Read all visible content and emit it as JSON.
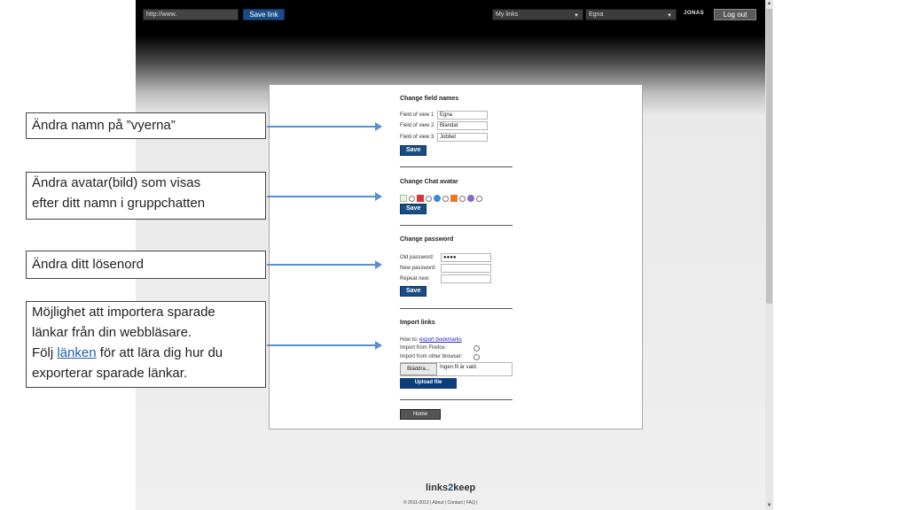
{
  "topbar": {
    "url_value": "http://www.",
    "save_link_label": "Save link",
    "links_select": "My links",
    "views_select": "Egna",
    "username": "JONAS",
    "logout_label": "Log out"
  },
  "panel": {
    "field_names": {
      "title": "Change field names",
      "rows": [
        {
          "label": "Field of view 1",
          "value": "Egna"
        },
        {
          "label": "Field of view 2",
          "value": "Blandat"
        },
        {
          "label": "Field of view 3",
          "value": "Jobbet"
        }
      ],
      "save_label": "Save"
    },
    "avatar": {
      "title": "Change Chat avatar",
      "save_label": "Save"
    },
    "password": {
      "title": "Change password",
      "old_label": "Old password:",
      "old_value": "●●●●",
      "new_label": "New password:",
      "repeat_label": "Repeat new:",
      "save_label": "Save"
    },
    "import": {
      "title": "Import links",
      "howto_label": "How to:",
      "howto_link": "export bookmarks",
      "firefox_label": "Import from Firefox:",
      "other_label": "Import from other browser:",
      "browse_label": "Bläddra...",
      "no_file_label": "Ingen fil är vald.",
      "upload_label": "Upload file"
    },
    "home_label": "Home"
  },
  "footer": {
    "brand_a": "links",
    "brand_b": "2",
    "brand_c": "keep",
    "links_text": "© 2011-2013 | About | Contact | FAQ |"
  },
  "callouts": {
    "views": "Ändra namn på ”vyerna”",
    "avatar_1": "Ändra avatar(bild) som visas",
    "avatar_2": "efter ditt namn i gruppchatten",
    "password": "Ändra ditt lösenord",
    "import_1": "Möjlighet att importera sparade",
    "import_2": "länkar från din webbläsare.",
    "import_3a": "Följ ",
    "import_3_link": "länken",
    "import_3b": " för att lära dig hur du",
    "import_4": "exporterar sparade länkar."
  },
  "colors": {
    "accent": "#1a4d86",
    "arrow": "#5a8fd0"
  }
}
